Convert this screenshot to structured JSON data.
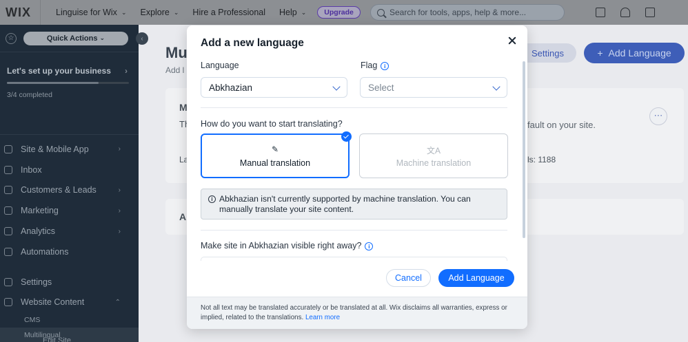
{
  "topbar": {
    "logo": "WIX",
    "site_name": "Linguise for Wix",
    "nav": [
      "Explore",
      "Hire a Professional",
      "Help"
    ],
    "upgrade": "Upgrade",
    "search_placeholder": "Search for tools, apps, help & more..."
  },
  "sidebar": {
    "quick_actions": "Quick Actions",
    "setup_title": "Let's set up your business",
    "setup_progress": "3/4 completed",
    "setup_fraction": 0.75,
    "items": [
      {
        "label": "Site & Mobile App",
        "arrow": true
      },
      {
        "label": "Inbox",
        "arrow": false
      },
      {
        "label": "Customers & Leads",
        "arrow": true
      },
      {
        "label": "Marketing",
        "arrow": true
      },
      {
        "label": "Analytics",
        "arrow": true
      },
      {
        "label": "Automations",
        "arrow": false
      }
    ],
    "settings": "Settings",
    "website_content": "Website Content",
    "sub_items": [
      "CMS",
      "Multilingual"
    ],
    "edit_site": "Edit Site"
  },
  "background": {
    "title": "Mu",
    "subtitle": "Add l",
    "settings_btn": "Settings",
    "add_language_btn": "Add Language",
    "card_text": "fault on your site.",
    "card_count": "ls: 1188",
    "letter_m": "M",
    "letter_t": "Th",
    "letter_l": "La",
    "letter_a": "A"
  },
  "dialog": {
    "title": "Add a new language",
    "language_label": "Language",
    "language_value": "Abkhazian",
    "flag_label": "Flag",
    "flag_placeholder": "Select",
    "question": "How do you want to start translating?",
    "manual_label": "Manual translation",
    "machine_label": "Machine translation",
    "notice": "Abkhazian isn't currently supported by machine translation. You can manually translate your site content.",
    "visible_label": "Make site in Abkhazian visible right away?",
    "cancel": "Cancel",
    "add": "Add Language",
    "footer_text": "Not all text may be translated accurately or be translated at all. Wix disclaims all warranties, express or implied, related to the translations.",
    "footer_link": "Learn more"
  },
  "colors": {
    "primary": "#116dff",
    "sidebar_bg": "#1f2c3a",
    "overlay_topbar": "#8c8f93"
  }
}
